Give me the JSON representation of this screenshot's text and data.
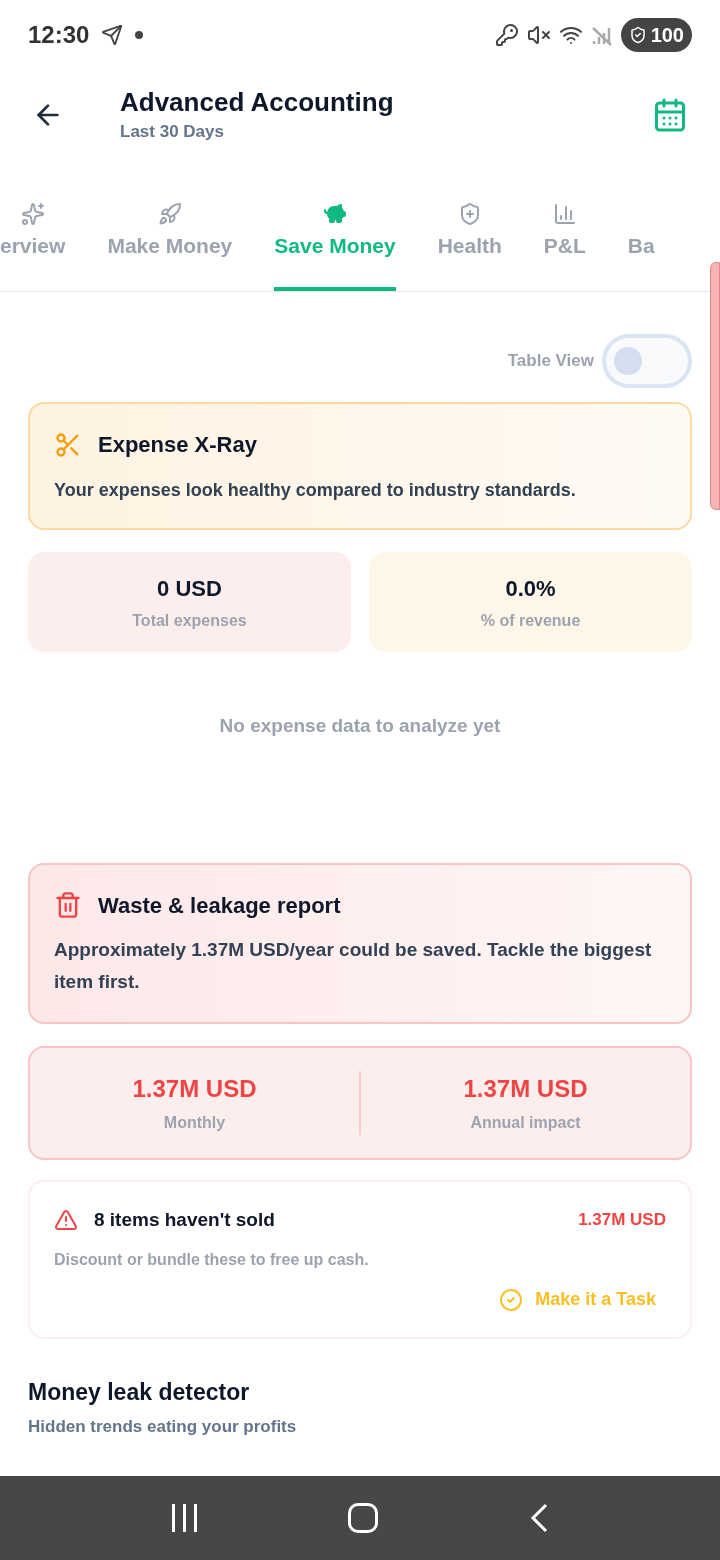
{
  "status_bar": {
    "time": "12:30",
    "battery": "100"
  },
  "header": {
    "title": "Advanced Accounting",
    "subtitle": "Last 30 Days"
  },
  "tabs": [
    {
      "label": "erview",
      "kind": "sparkle",
      "selected": false
    },
    {
      "label": "Make Money",
      "kind": "rocket",
      "selected": false
    },
    {
      "label": "Save Money",
      "kind": "piggy",
      "selected": true
    },
    {
      "label": "Health",
      "kind": "shield",
      "selected": false
    },
    {
      "label": "P&L",
      "kind": "bars",
      "selected": false
    },
    {
      "label": "Ba",
      "kind": "none",
      "selected": false
    }
  ],
  "table_view": {
    "label": "Table View",
    "on": false
  },
  "expense_xray": {
    "title": "Expense X-Ray",
    "message": "Your expenses look healthy compared to industry standards.",
    "stats": [
      {
        "value": "0 USD",
        "label": "Total expenses",
        "color": "#fdeeee"
      },
      {
        "value": "0.0%",
        "label": "% of revenue",
        "color": "#fef6e9"
      }
    ],
    "empty": "No expense data to analyze yet"
  },
  "waste_report": {
    "title": "Waste & leakage report",
    "message": "Approximately 1.37M USD/year could be saved. Tackle the biggest item first.",
    "stats": [
      {
        "value": "1.37M USD",
        "label": "Monthly"
      },
      {
        "value": "1.37M USD",
        "label": "Annual impact"
      }
    ],
    "items": [
      {
        "title": "8 items haven't sold",
        "amount": "1.37M USD",
        "description": "Discount or bundle these to free up cash.",
        "action": "Make it a Task"
      }
    ]
  },
  "money_leak": {
    "title": "Money leak detector",
    "subtitle": "Hidden trends eating your profits"
  }
}
